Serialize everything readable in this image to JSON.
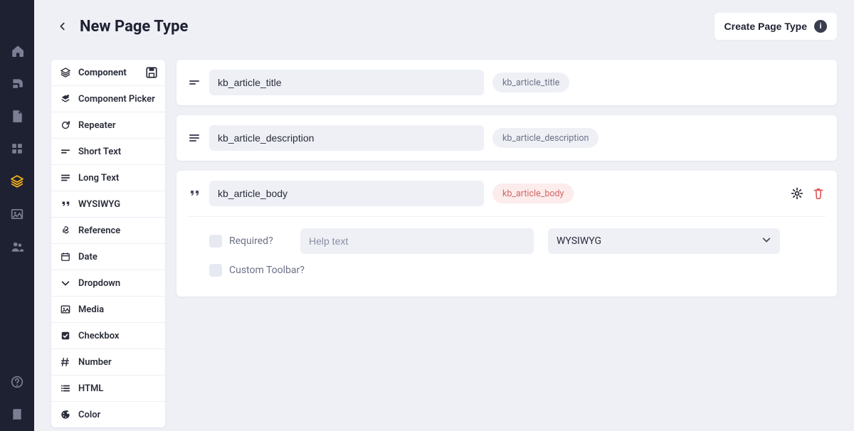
{
  "header": {
    "title": "New Page Type",
    "create_label": "Create Page Type"
  },
  "palette": {
    "items": [
      {
        "label": "Component",
        "icon": "layers-icon",
        "top": true
      },
      {
        "label": "Component Picker",
        "icon": "layers-plus-icon"
      },
      {
        "label": "Repeater",
        "icon": "refresh-icon"
      },
      {
        "label": "Short Text",
        "icon": "short-text-icon"
      },
      {
        "label": "Long Text",
        "icon": "long-text-icon"
      },
      {
        "label": "WYSIWYG",
        "icon": "quote-icon"
      },
      {
        "label": "Reference",
        "icon": "link-icon"
      },
      {
        "label": "Date",
        "icon": "calendar-icon"
      },
      {
        "label": "Dropdown",
        "icon": "chevron-down-icon"
      },
      {
        "label": "Media",
        "icon": "image-icon"
      },
      {
        "label": "Checkbox",
        "icon": "checkbox-icon"
      },
      {
        "label": "Number",
        "icon": "hash-icon"
      },
      {
        "label": "HTML",
        "icon": "list-icon"
      },
      {
        "label": "Color",
        "icon": "palette-icon"
      }
    ]
  },
  "fields": [
    {
      "type_icon": "short-text-icon",
      "name": "kb_article_title",
      "slug": "kb_article_title",
      "expanded": false
    },
    {
      "type_icon": "long-text-icon",
      "name": "kb_article_description",
      "slug": "kb_article_description",
      "expanded": false
    },
    {
      "type_icon": "quote-icon",
      "name": "kb_article_body",
      "slug": "kb_article_body",
      "expanded": true,
      "accent": true,
      "settings": {
        "required_label": "Required?",
        "help_placeholder": "Help text",
        "type_select": "WYSIWYG",
        "custom_toolbar_label": "Custom Toolbar?"
      }
    }
  ]
}
